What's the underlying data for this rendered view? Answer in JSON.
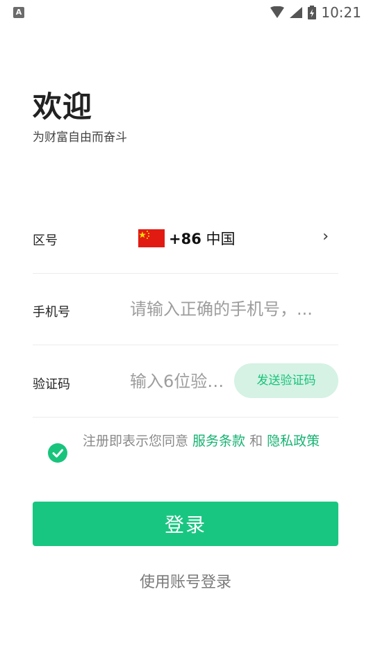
{
  "status_bar": {
    "indicator": "A",
    "time": "10:21",
    "icons": [
      "wifi-icon",
      "signal-icon",
      "battery-icon"
    ]
  },
  "header": {
    "title": "欢迎",
    "subtitle": "为财富自由而奋斗"
  },
  "form": {
    "region": {
      "label": "区号",
      "code": "+86",
      "country": "中国",
      "chevron": "›"
    },
    "phone": {
      "label": "手机号",
      "value": "",
      "placeholder": "请输入正确的手机号，..."
    },
    "verify": {
      "label": "验证码",
      "value": "",
      "placeholder": "输入6位验证码",
      "send_label": "发送验证码"
    }
  },
  "agreement": {
    "checked": true,
    "prefix": "注册即表示您同意 ",
    "terms": "服务条款",
    "and": " 和 ",
    "privacy": "隐私政策"
  },
  "login_button": "登录",
  "account_login": "使用账号登录",
  "colors": {
    "accent": "#19c681",
    "accent_light": "#d5f2e4",
    "link": "#15b271",
    "flag_red": "#e11b12",
    "flag_star": "#ffde00"
  }
}
